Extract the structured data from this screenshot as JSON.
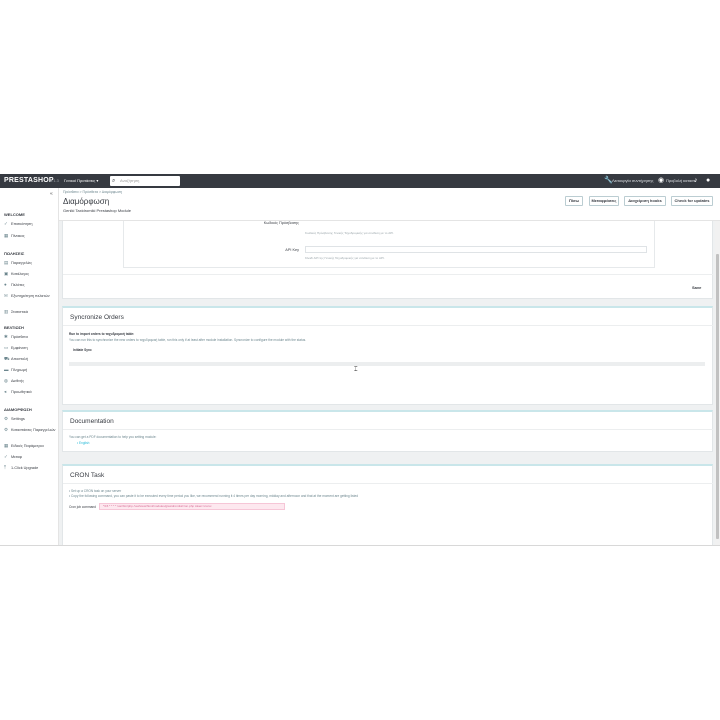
{
  "topbar": {
    "logo": "PRESTASHOP",
    "version": "8.1.3",
    "shop": "Γενικοί Προτάσεις ▾",
    "search_placeholder": "Αναζήτηση",
    "quick_access": "Λειτουργία συντήρησης",
    "view_store": "Προβολή καταστ."
  },
  "sidebar": {
    "collapse": "«",
    "sections": [
      {
        "title": "WELCOME",
        "items": [
          {
            "icon": "✓",
            "label": "Επισκόπηση"
          },
          {
            "icon": "▦",
            "label": "Πίνακας"
          }
        ]
      },
      {
        "title": "ΠΩΛΗΣΕΙΣ",
        "items": [
          {
            "icon": "▤",
            "label": "Παραγγελίες"
          },
          {
            "icon": "▣",
            "label": "Κατάλογος"
          },
          {
            "icon": "●",
            "label": "Πελάτες"
          },
          {
            "icon": "✉",
            "label": "Εξυπηρέτηση πελατών"
          },
          {
            "icon": "▥",
            "label": "Στατιστικά"
          }
        ]
      },
      {
        "title": "ΒΕΛΤΙΩΣΗ",
        "items": [
          {
            "icon": "✱",
            "label": "Πρόσθετα"
          },
          {
            "icon": "▭",
            "label": "Εμφάνιση"
          },
          {
            "icon": "⛟",
            "label": "Αποστολή"
          },
          {
            "icon": "▬",
            "label": "Πληρωμή"
          },
          {
            "icon": "◍",
            "label": "Διεθνής"
          },
          {
            "icon": "◂",
            "label": "Προωθητικά"
          }
        ]
      },
      {
        "title": "ΔΙΑΜΟΡΦΩΣΗ",
        "items": [
          {
            "icon": "⚙",
            "label": "Settings"
          },
          {
            "icon": "⚙",
            "label": "Καταστάσεις Παραγγελιών"
          },
          {
            "icon": "▦",
            "label": "Ειδικές Παράμετροι"
          },
          {
            "icon": "✓",
            "label": "Μεταφ"
          },
          {
            "icon": "⤒",
            "label": "1-Click Upgrade"
          }
        ]
      }
    ]
  },
  "header": {
    "breadcrumb": "Πρόσθετα > Πρόσθετα > Διαμόρφωση",
    "title": "Διαμόρφωση",
    "subtitle": "Geniki Taxidromiki Prestashop Module",
    "buttons": [
      "Πίσω",
      "Μεταφράσεις",
      "Διαχείριση hooks",
      "Check for updates"
    ]
  },
  "settings_panel": {
    "code_label": "Κωδικός Πρόσβασης",
    "code_help": "Κωδικός Πρόσβασης Γενικής Ταχυδρομικής για σύνδεση με το API.",
    "api_label": "API Key",
    "api_help": "Κλειδί API της Γενικής Ταχυδρομικής για σύνδεση με το API.",
    "save": "Save"
  },
  "sync_panel": {
    "title": "Syncronize Orders",
    "subtitle": "Run to import orders to ταχυδρομική table:",
    "desc": "You can run this to synchronize the new orders to ταχυδρομική table, run this only if at least after module installation. Syncronize to configure the module with the status.",
    "button": "Initiate Sync"
  },
  "doc_panel": {
    "title": "Documentation",
    "line1": "You can get a PDF documentation to help you setting module:",
    "line2": "• English"
  },
  "cron_panel": {
    "title": "CRON Task",
    "line1": "• Set up a CRON task on your server",
    "line2": "• Copy the following command, you can paste it to be executed every time period you like, we recommend running it 4 times per day morning, midday and afternoon and that at the moment are getting listed",
    "label": "Cron job command",
    "command": "*/15 * * * * /usr/bin/php /var/www/html/modules/gtaxidromiki/cron.php token=xxxxx"
  }
}
